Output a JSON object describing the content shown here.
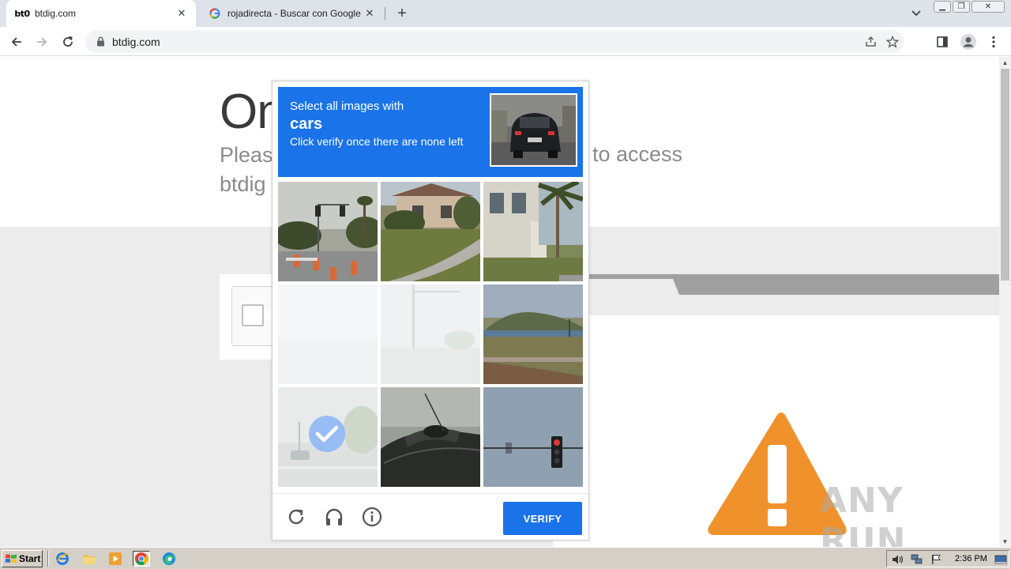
{
  "browser": {
    "tabs": [
      {
        "title": "btdig.com",
        "favicon": "bt0",
        "active": true
      },
      {
        "title": "rojadirecta - Buscar con Google",
        "favicon": "google-icon",
        "active": false
      }
    ],
    "url": "btdig.com"
  },
  "page": {
    "heading_fragment": "On",
    "subtitle_left": "Pleas",
    "subtitle_right": "to access",
    "subtitle_line2": "btdig"
  },
  "captcha": {
    "instruction_line1": "Select all images with",
    "target_object": "cars",
    "instruction_line3": "Click verify once there are none left",
    "tiles": [
      {
        "scene": "intersection-traffic-lights",
        "selected": false,
        "faded": false
      },
      {
        "scene": "house-lawn-sidewalk",
        "selected": false,
        "faded": false
      },
      {
        "scene": "building-palm-tree",
        "selected": false,
        "faded": false
      },
      {
        "scene": "blank-loading",
        "selected": false,
        "faded": true
      },
      {
        "scene": "street-pole-loading",
        "selected": false,
        "faded": true
      },
      {
        "scene": "coast-hillside",
        "selected": false,
        "faded": false
      },
      {
        "scene": "road-with-car",
        "selected": true,
        "faded": true
      },
      {
        "scene": "vehicle-roof-closeup",
        "selected": false,
        "faded": false
      },
      {
        "scene": "traffic-light-sky",
        "selected": false,
        "faded": false
      }
    ],
    "verify_label": "VERIFY",
    "colors": {
      "header": "#1a73e8",
      "button": "#1a73e8"
    }
  },
  "watermark": {
    "text": "ANY RUN"
  },
  "taskbar": {
    "start_label": "Start",
    "clock": "2:36 PM"
  }
}
